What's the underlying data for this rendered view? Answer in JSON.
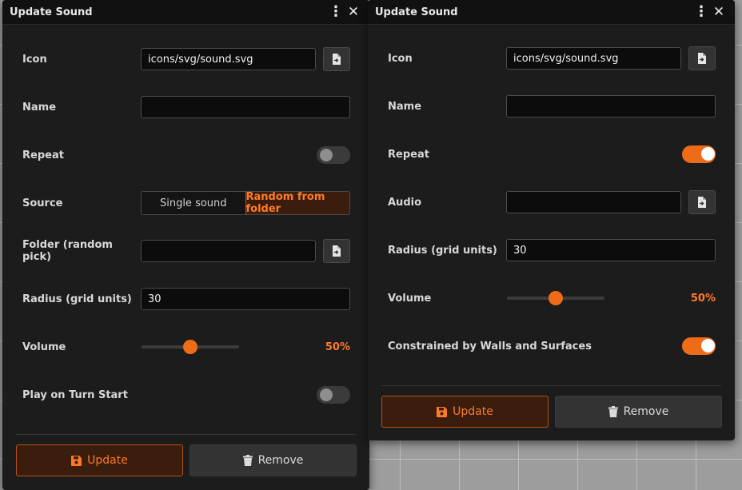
{
  "windows": [
    {
      "title": "Update Sound",
      "icon_label": "Icon",
      "icon_path": "icons/svg/sound.svg",
      "name_label": "Name",
      "name_value": "",
      "repeat_label": "Repeat",
      "repeat_on": false,
      "source_label": "Source",
      "source_options": [
        "Single sound",
        "Random from folder"
      ],
      "source_selected": "Random from folder",
      "folder_label": "Folder (random pick)",
      "folder_value": "",
      "radius_label": "Radius (grid units)",
      "radius_value": "30",
      "volume_label": "Volume",
      "volume_pct": 50,
      "volume_text": "50%",
      "play_on_turn_label": "Play on Turn Start",
      "play_on_turn_on": false,
      "update_label": "Update",
      "remove_label": "Remove"
    },
    {
      "title": "Update Sound",
      "icon_label": "Icon",
      "icon_path": "icons/svg/sound.svg",
      "name_label": "Name",
      "name_value": "",
      "repeat_label": "Repeat",
      "repeat_on": true,
      "audio_label": "Audio",
      "audio_value": "",
      "radius_label": "Radius (grid units)",
      "radius_value": "30",
      "volume_label": "Volume",
      "volume_pct": 50,
      "volume_text": "50%",
      "constrained_label": "Constrained by Walls and Surfaces",
      "constrained_on": true,
      "update_label": "Update",
      "remove_label": "Remove"
    }
  ],
  "icons": {
    "menu": "kebab-menu-icon",
    "close": "close-icon",
    "file_picker": "file-import-icon",
    "update": "floppy-disk-icon",
    "remove": "trash-icon"
  },
  "colors": {
    "accent": "#ee6b17",
    "accent_text": "#ff7a2a",
    "panel_bg": "#1c1c1c",
    "titlebar_bg": "#111111"
  }
}
